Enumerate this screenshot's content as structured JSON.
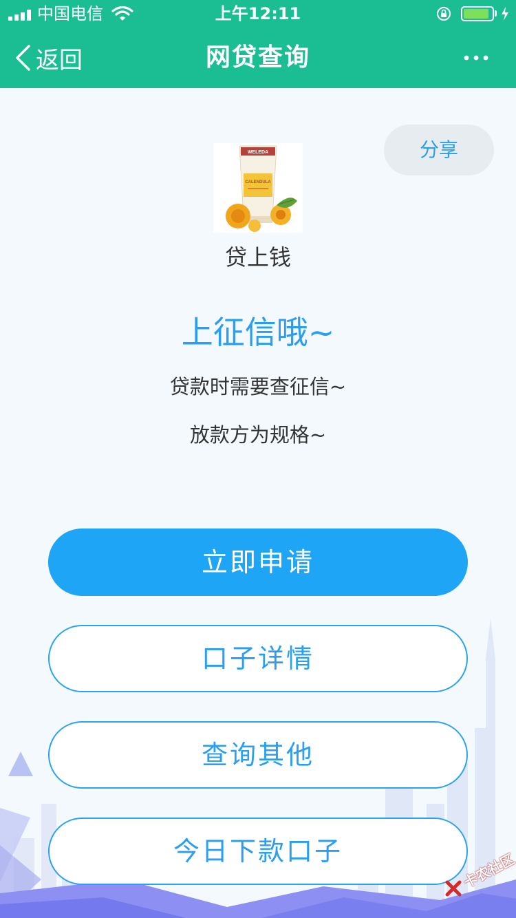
{
  "status_bar": {
    "carrier": "中国电信",
    "time": "上午12:11",
    "battery_level": 0.9
  },
  "nav": {
    "back_label": "返回",
    "title": "网贷查询",
    "more_icon": "more-dots-icon"
  },
  "share": {
    "label": "分享"
  },
  "product": {
    "image_brand": "WELEDA",
    "image_label": "CALENDULA",
    "name": "贷上钱"
  },
  "info": {
    "headline": "上征信哦~",
    "line1": "贷款时需要查征信~",
    "line2": "放款方为规格~"
  },
  "actions": {
    "apply": "立即申请",
    "details": "口子详情",
    "query_other": "查询其他",
    "today": "今日下款口子"
  },
  "watermark": {
    "text": "卡农社区"
  },
  "colors": {
    "header": "#1bbd93",
    "accent": "#1fa5f5",
    "accent_text": "#2a9ef0",
    "page_bg": "#f3f9fd"
  }
}
